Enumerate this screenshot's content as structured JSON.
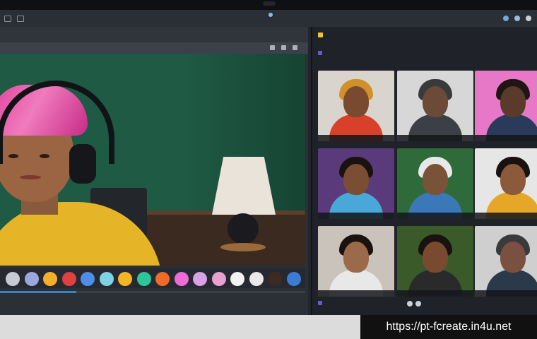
{
  "menubar": {
    "left_text": "",
    "center_text": ""
  },
  "left_window": {
    "title": ""
  },
  "swatches": [
    {
      "color": "#c9c9d6"
    },
    {
      "color": "#9aa6e0"
    },
    {
      "color": "#f2b02a"
    },
    {
      "color": "#e04040"
    },
    {
      "color": "#4c8fe8"
    },
    {
      "color": "#7fd1e6"
    },
    {
      "color": "#f2b624"
    },
    {
      "color": "#2fc59a"
    },
    {
      "color": "#f06a2a"
    },
    {
      "color": "#f06ad8"
    },
    {
      "color": "#d8a0e6"
    },
    {
      "color": "#e8a0d0"
    },
    {
      "color": "#f2f2f2"
    },
    {
      "color": "#e8e8e8"
    },
    {
      "color": "#3a2a22"
    },
    {
      "color": "#3a7bd5"
    }
  ],
  "progress": 0.25,
  "right_panel": {
    "header": "",
    "subheader": "",
    "footer": ""
  },
  "participants": [
    {
      "bg": "#d9d4ce",
      "skin": "#7a4a30",
      "hair": "#d0902a",
      "shirt": "#d8402a"
    },
    {
      "bg": "#d7d7d7",
      "skin": "#6b4a38",
      "hair": "#3a3a3a",
      "shirt": "#3c3f45"
    },
    {
      "bg": "#e778c7",
      "skin": "#5a3a2a",
      "hair": "#1e1613",
      "shirt": "#2a3a5a"
    },
    {
      "bg": "#5a3a7a",
      "skin": "#7a4e32",
      "hair": "#1a1210",
      "shirt": "#4aa8d8"
    },
    {
      "bg": "#2e6a3a",
      "skin": "#7a5238",
      "hair": "#e8e8e8",
      "shirt": "#3a78b8"
    },
    {
      "bg": "#e6e6e6",
      "skin": "#8a5a3a",
      "hair": "#1a1210",
      "shirt": "#e6a628"
    },
    {
      "bg": "#c9c3bb",
      "skin": "#9a6a4a",
      "hair": "#1a1210",
      "shirt": "#e8e8e8"
    },
    {
      "bg": "#3a5a2a",
      "skin": "#7a4a30",
      "hair": "#1a1210",
      "shirt": "#2a2a2a"
    },
    {
      "bg": "#cfcfcf",
      "skin": "#7a5040",
      "hair": "#3a3a3a",
      "shirt": "#2a3a4a"
    }
  ],
  "watermark": "https://pt-fcreate.in4u.net"
}
